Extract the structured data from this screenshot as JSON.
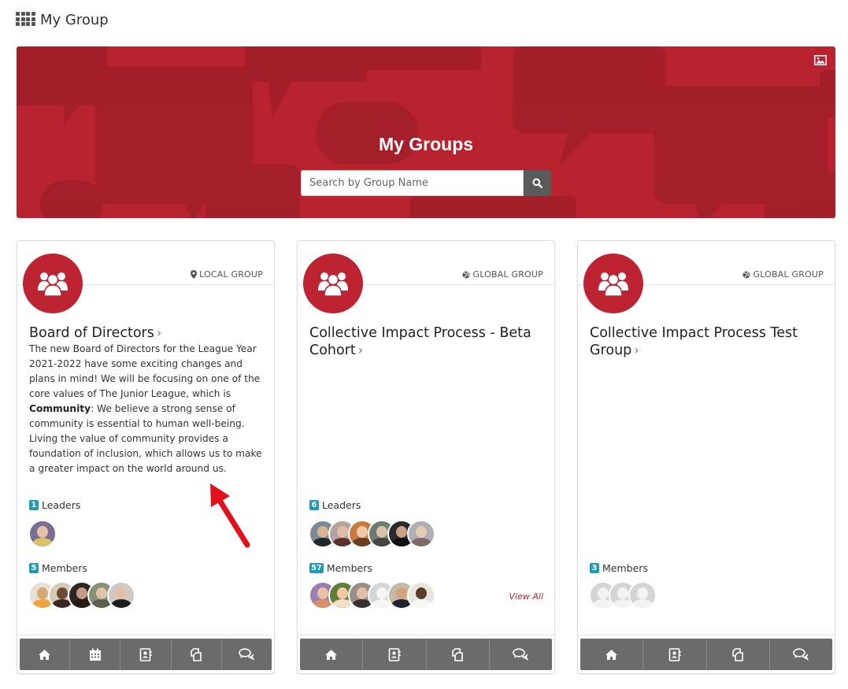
{
  "page": {
    "title": "My Group",
    "grid_icon": "apps-grid-icon"
  },
  "hero": {
    "title": "My Groups",
    "search_placeholder": "Search by Group Name",
    "search_icon": "search-icon",
    "image_icon": "image-icon",
    "color": "#b8232f"
  },
  "cards": [
    {
      "type_label": "LOCAL GROUP",
      "type_icon": "map-marker-icon",
      "title": "Board of Directors",
      "description_pre": "The new Board of Directors for the League Year 2021-2022 have some exciting changes and plans in mind! We will be focusing on one of the core values of The Junior League, which is ",
      "description_bold": "Community",
      "description_post": ": We believe a strong sense of community is essential to human well-being. Living the value of community provides a foundation of inclusion, which allows us to make a greater impact on the world around us.",
      "leaders_count": "1",
      "leaders_label": "Leaders",
      "members_count": "5",
      "members_label": "Members",
      "footer": [
        "home-icon",
        "calendar-icon",
        "directory-icon",
        "documents-icon",
        "discussions-icon"
      ]
    },
    {
      "type_label": "GLOBAL GROUP",
      "type_icon": "globe-icon",
      "title": "Collective Impact Process - Beta Cohort",
      "leaders_count": "6",
      "leaders_label": "Leaders",
      "members_count": "57",
      "members_label": "Members",
      "view_all": "View All",
      "footer": [
        "home-icon",
        "directory-icon",
        "documents-icon",
        "discussions-icon"
      ]
    },
    {
      "type_label": "GLOBAL GROUP",
      "type_icon": "globe-icon",
      "title": "Collective Impact Process Test Group",
      "members_count": "3",
      "members_label": "Members",
      "footer": [
        "home-icon",
        "directory-icon",
        "documents-icon",
        "discussions-icon"
      ]
    }
  ],
  "annotation": {
    "arrow_color": "#e3111b"
  }
}
